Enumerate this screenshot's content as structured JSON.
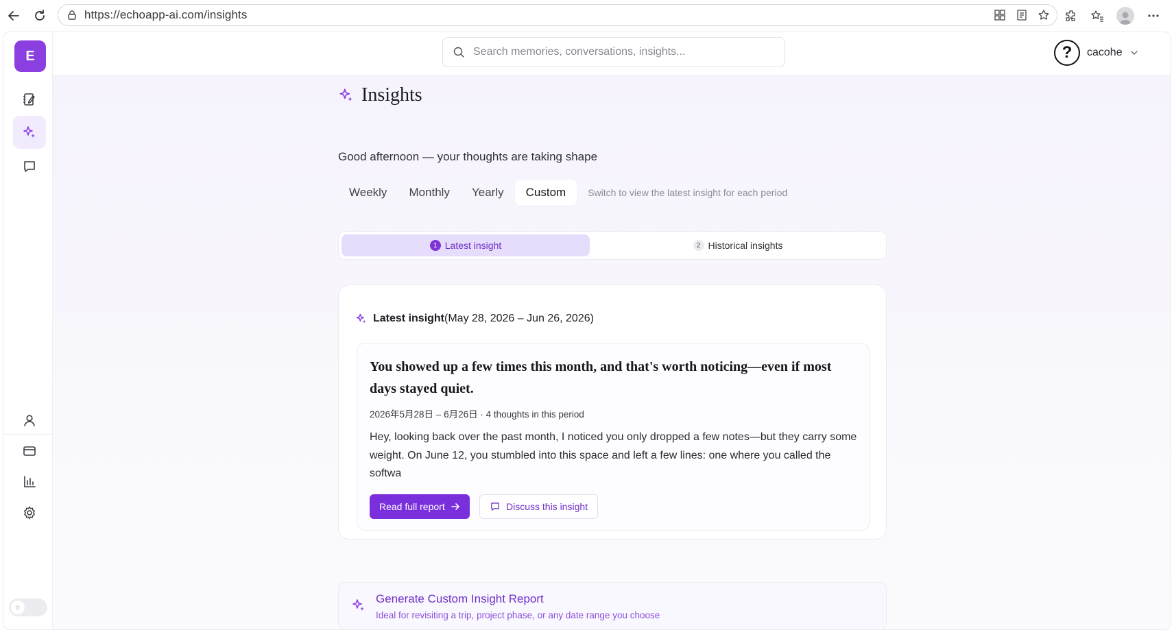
{
  "browser": {
    "url": "https://echoapp-ai.com/insights"
  },
  "sidebar": {
    "logo_letter": "E"
  },
  "topbar": {
    "search_placeholder": "Search memories, conversations, insights...",
    "avatar_glyph": "?",
    "username": "cacohe"
  },
  "page": {
    "title": "Insights",
    "subtitle": "Good afternoon — your thoughts are taking shape",
    "period_tabs": [
      {
        "label": "Weekly",
        "active": false
      },
      {
        "label": "Monthly",
        "active": false
      },
      {
        "label": "Yearly",
        "active": false
      },
      {
        "label": "Custom",
        "active": true
      }
    ],
    "tab_hint": "Switch to view the latest insight for each period"
  },
  "insight_switch": {
    "latest": {
      "num": "1",
      "label": "Latest insight"
    },
    "historical": {
      "num": "2",
      "label": "Historical insights"
    }
  },
  "card": {
    "head_bold": "Latest insight",
    "head_range": "(May 28, 2026 – Jun 26, 2026)",
    "headline": "You showed up a few times this month, and that's worth noticing—even if most days stayed quiet.",
    "meta": "2026年5月28日 – 6月26日 · 4 thoughts in this period",
    "body": "Hey, looking back over the past month, I noticed you only dropped a few notes—but they carry some weight. On June 12, you stumbled into this space and left a few lines: one where you called the softwa",
    "read_button": "Read full report",
    "discuss_button": "Discuss this insight"
  },
  "generate": {
    "title": "Generate Custom Insight Report",
    "subtitle": "Ideal for revisiting a trip, project phase, or any date range you choose"
  },
  "colors": {
    "accent": "#7a2fdc",
    "accent_light": "#e6dcfb"
  }
}
